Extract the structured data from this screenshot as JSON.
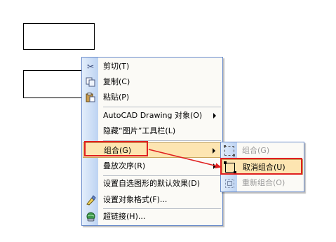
{
  "context_menu": {
    "items": [
      {
        "label": "剪切(T)",
        "icon": "scissors-icon"
      },
      {
        "label": "复制(C)",
        "icon": "copy-icon"
      },
      {
        "label": "粘贴(P)",
        "icon": "paste-icon"
      },
      {
        "label": "AutoCAD Drawing 对象(O)",
        "has_submenu": true
      },
      {
        "label": "隐藏“图片”工具栏(L)"
      },
      {
        "label": "组合(G)",
        "has_submenu": true,
        "highlighted": true
      },
      {
        "label": "叠放次序(R)",
        "has_submenu": true
      },
      {
        "label": "设置自选图形的默认效果(D)"
      },
      {
        "label": "设置对象格式(F)...",
        "icon": "format-object-icon"
      },
      {
        "label": "超链接(H)...",
        "icon": "hyperlink-icon"
      }
    ]
  },
  "submenu": {
    "items": [
      {
        "label": "组合(G)",
        "icon": "group-icon",
        "disabled": true
      },
      {
        "label": "取消组合(U)",
        "icon": "ungroup-icon",
        "highlighted": true
      },
      {
        "label": "重新组合(O)",
        "icon": "regroup-icon",
        "disabled": true
      }
    ]
  },
  "colors": {
    "annotation": "#e02020",
    "highlight": "#fde5b1",
    "menu_border": "#6a8ccb"
  }
}
